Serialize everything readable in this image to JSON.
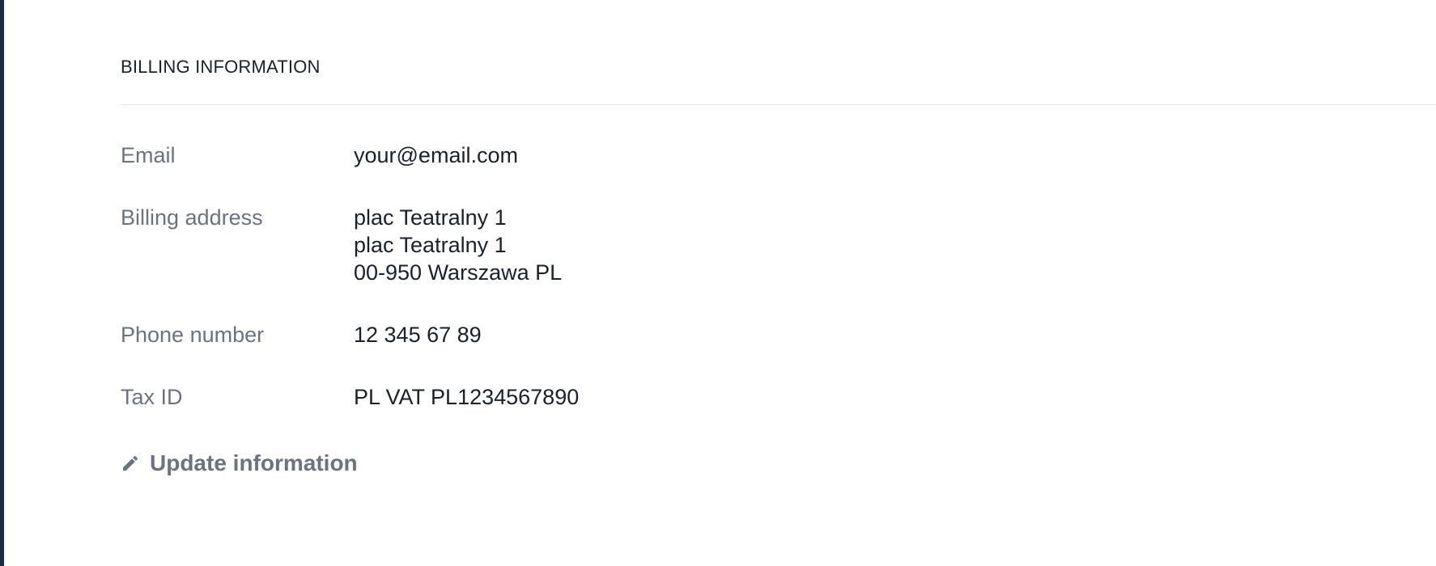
{
  "section": {
    "title": "BILLING INFORMATION"
  },
  "fields": {
    "email": {
      "label": "Email",
      "value": "your@email.com"
    },
    "billing_address": {
      "label": "Billing address",
      "lines": [
        "plac Teatralny 1",
        "plac Teatralny 1",
        "00-950 Warszawa PL"
      ]
    },
    "phone": {
      "label": "Phone number",
      "value": "12 345 67 89"
    },
    "tax_id": {
      "label": "Tax ID",
      "value": "PL VAT PL1234567890"
    }
  },
  "actions": {
    "update_label": "Update information",
    "update_icon": "pencil-icon"
  },
  "colors": {
    "text_primary": "#1a202c",
    "text_muted": "#6b7280",
    "divider": "#e2e5ea",
    "sidebar_edge": "#1f2a44"
  }
}
